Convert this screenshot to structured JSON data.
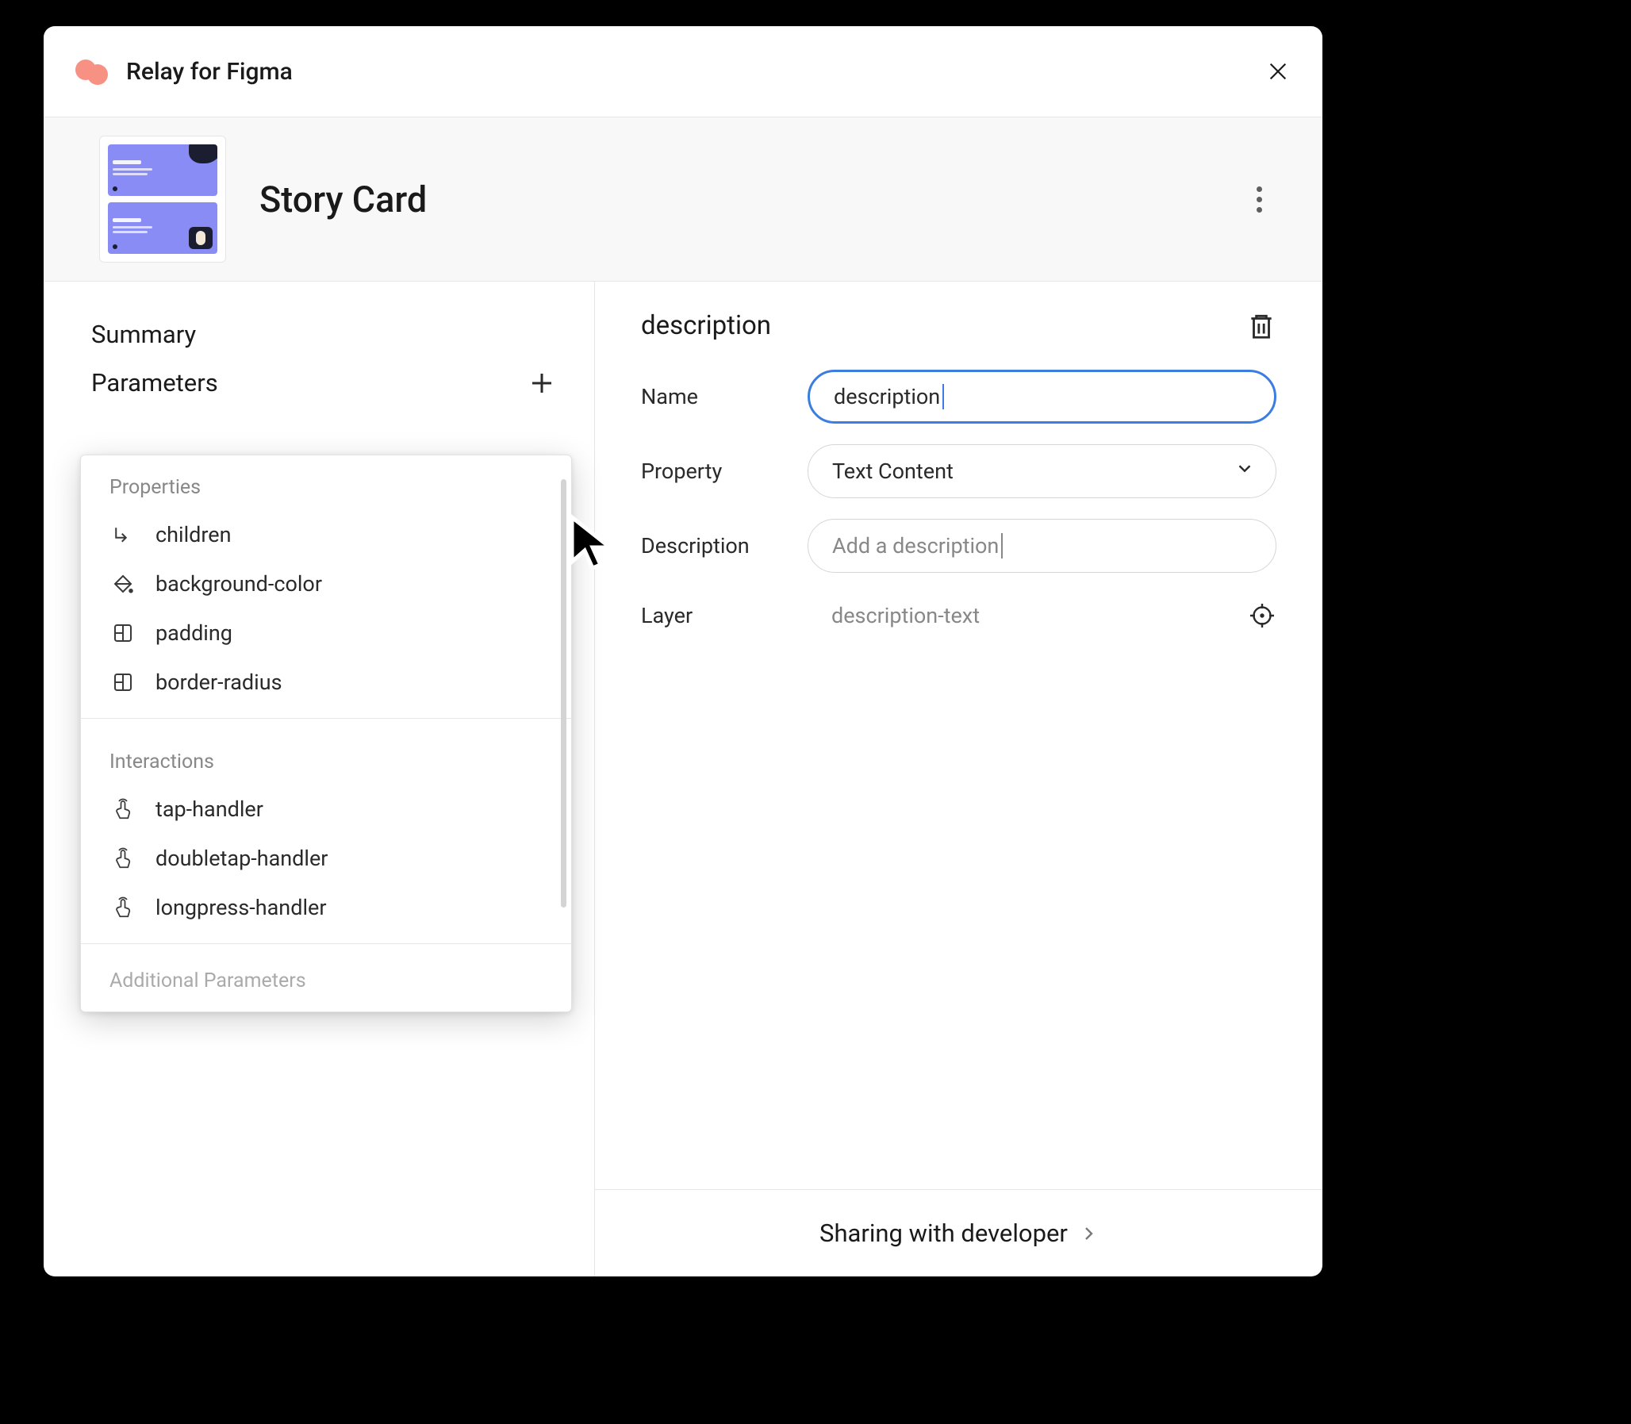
{
  "app": {
    "title": "Relay for Figma"
  },
  "component": {
    "title": "Story Card"
  },
  "sidebar": {
    "summary_label": "Summary",
    "parameters_label": "Parameters"
  },
  "popup": {
    "properties_label": "Properties",
    "interactions_label": "Interactions",
    "footer_label": "Additional Parameters",
    "properties": [
      {
        "icon": "children-icon",
        "label": "children"
      },
      {
        "icon": "fill-icon",
        "label": "background-color"
      },
      {
        "icon": "box-icon",
        "label": "padding"
      },
      {
        "icon": "box-icon",
        "label": "border-radius"
      }
    ],
    "interactions": [
      {
        "icon": "tap-icon",
        "label": "tap-handler"
      },
      {
        "icon": "tap-icon",
        "label": "doubletap-handler"
      },
      {
        "icon": "tap-icon",
        "label": "longpress-handler"
      }
    ]
  },
  "detail": {
    "title": "description",
    "name_label": "Name",
    "name_value": "description",
    "property_label": "Property",
    "property_value": "Text Content",
    "description_label": "Description",
    "description_placeholder": "Add a description",
    "layer_label": "Layer",
    "layer_value": "description-text"
  },
  "footer": {
    "label": "Sharing with developer"
  }
}
